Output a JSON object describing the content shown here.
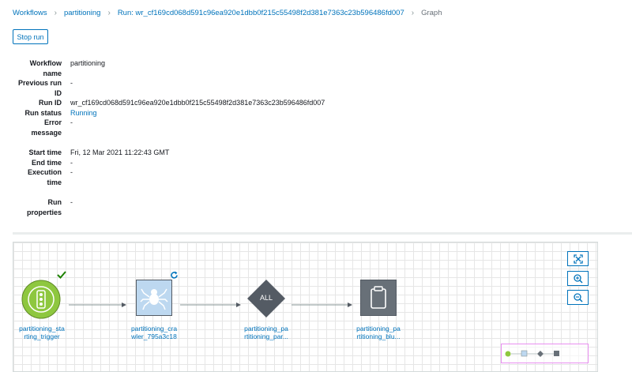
{
  "breadcrumb": {
    "items": [
      "Workflows",
      "partitioning",
      "Run: wr_cf169cd068d591c96ea920e1dbb0f215c55498f2d381e7363c23b596486fd007"
    ],
    "current": "Graph"
  },
  "actions": {
    "stop_run": "Stop run"
  },
  "details": {
    "workflow_name_l1": "Workflow",
    "workflow_name_l2": "name",
    "workflow_name": "partitioning",
    "previous_run_l1": "Previous run",
    "previous_run_l2": "ID",
    "previous_run": "-",
    "run_id_label": "Run ID",
    "run_id": "wr_cf169cd068d591c96ea920e1dbb0f215c55498f2d381e7363c23b596486fd007",
    "run_status_label": "Run status",
    "run_status": "Running",
    "error_l1": "Error",
    "error_l2": "message",
    "error": "-",
    "start_time_label": "Start time",
    "start_time": "Fri, 12 Mar 2021 11:22:43 GMT",
    "end_time_label": "End time",
    "end_time": "-",
    "execution_l1": "Execution",
    "execution_l2": "time",
    "execution": "-",
    "run_props_l1": "Run",
    "run_props_l2": "properties",
    "run_props": "-"
  },
  "graph": {
    "nodes": [
      {
        "l1": "partitioning_sta",
        "l2": "rting_trigger",
        "type": "trigger",
        "status": "succeeded"
      },
      {
        "l1": "partitioning_cra",
        "l2": "wler_795a3c18",
        "type": "crawler",
        "status": "running"
      },
      {
        "l1": "partitioning_pa",
        "l2": "rtitioning_par...",
        "type": "condition",
        "badge": "ALL"
      },
      {
        "l1": "partitioning_pa",
        "l2": "rtitioning_blu...",
        "type": "job"
      }
    ],
    "controls": [
      "fit-to-screen-icon",
      "zoom-in-icon",
      "zoom-out-icon"
    ]
  },
  "colors": {
    "link": "#0073bb",
    "success": "#1d8102",
    "trigger_fill": "#8ec73f",
    "crawler_fill": "#bdd8f0",
    "condition_fill": "#545b64",
    "job_fill": "#687078",
    "minimap_border": "#e88ff0"
  }
}
